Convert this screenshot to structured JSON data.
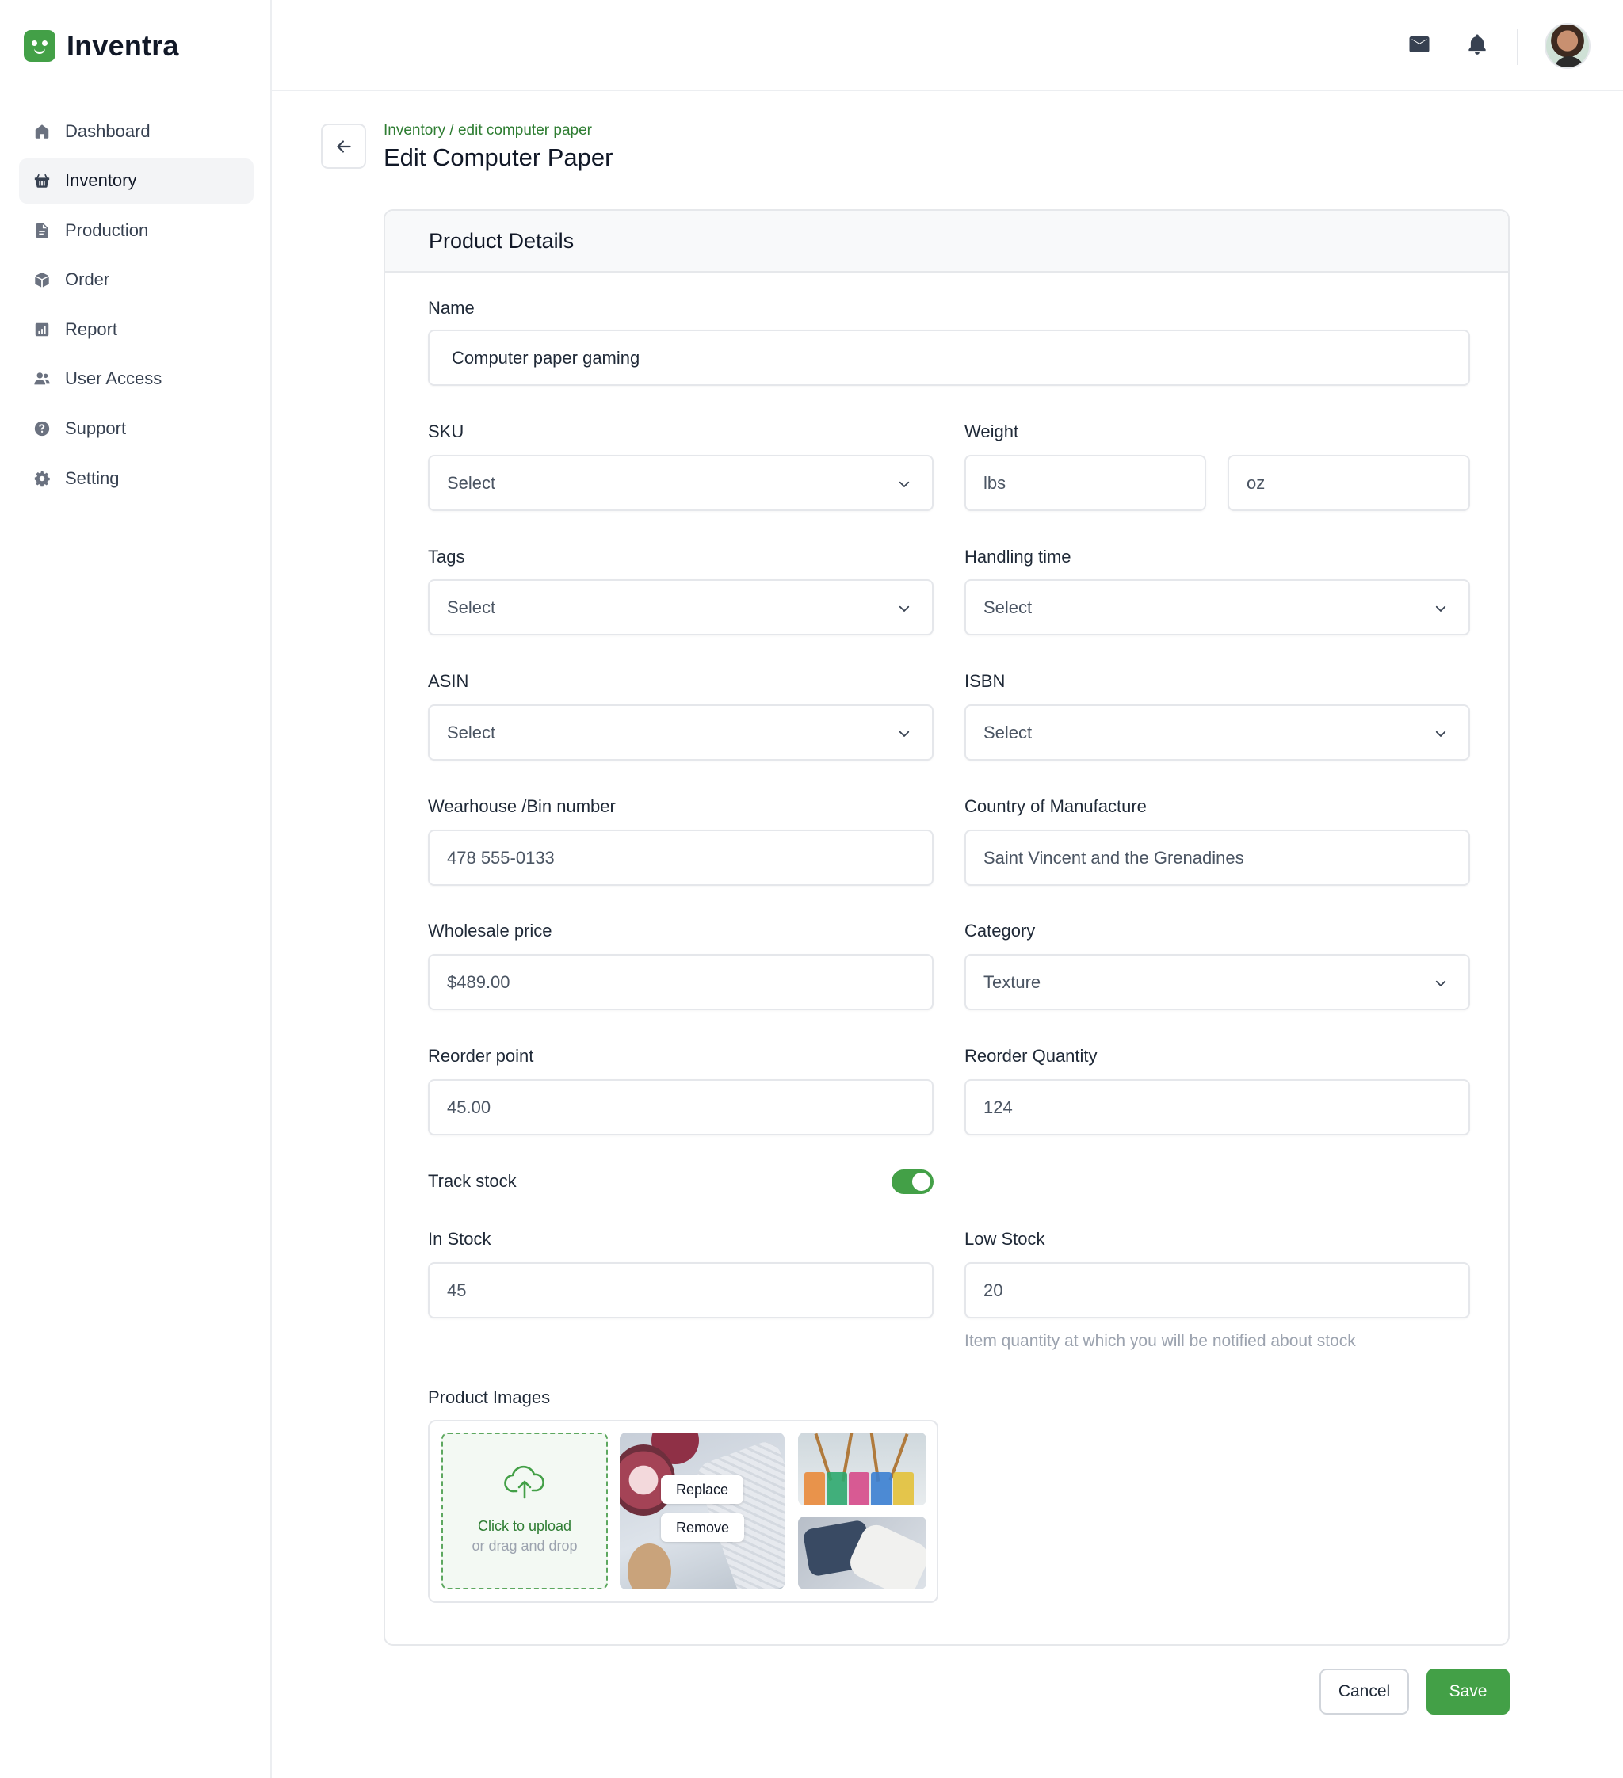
{
  "brand": {
    "name": "Inventra",
    "color": "#43a047"
  },
  "sidebar": {
    "items": [
      {
        "label": "Dashboard",
        "icon": "home-icon",
        "active": false
      },
      {
        "label": "Inventory",
        "icon": "basket-icon",
        "active": true
      },
      {
        "label": "Production",
        "icon": "document-icon",
        "active": false
      },
      {
        "label": "Order",
        "icon": "box-icon",
        "active": false
      },
      {
        "label": "Report",
        "icon": "chart-icon",
        "active": false
      },
      {
        "label": "User Access",
        "icon": "users-icon",
        "active": false
      },
      {
        "label": "Support",
        "icon": "help-icon",
        "active": false
      },
      {
        "label": "Setting",
        "icon": "gear-icon",
        "active": false
      }
    ]
  },
  "topbar": {
    "icons": [
      "mail-icon",
      "bell-icon"
    ]
  },
  "header": {
    "breadcrumb": "Inventory / edit computer paper",
    "title": "Edit Computer Paper"
  },
  "form": {
    "section_title": "Product Details",
    "name": {
      "label": "Name",
      "value": "Computer paper gaming"
    },
    "sku": {
      "label": "SKU",
      "value": "Select"
    },
    "weight": {
      "label": "Weight",
      "lbs_placeholder": "lbs",
      "oz_placeholder": "oz"
    },
    "tags": {
      "label": "Tags",
      "value": "Select"
    },
    "handling_time": {
      "label": "Handling time",
      "value": "Select"
    },
    "asin": {
      "label": "ASIN",
      "value": "Select"
    },
    "isbn": {
      "label": "ISBN",
      "value": "Select"
    },
    "warehouse": {
      "label": "Wearhouse /Bin number",
      "value": "478 555-0133"
    },
    "country": {
      "label": "Country of Manufacture",
      "value": "Saint Vincent and the Grenadines"
    },
    "wholesale_price": {
      "label": "Wholesale price",
      "value": "$489.00"
    },
    "category": {
      "label": "Category",
      "value": "Texture"
    },
    "reorder_point": {
      "label": "Reorder point",
      "value": "45.00"
    },
    "reorder_quantity": {
      "label": "Reorder Quantity",
      "value": "124"
    },
    "track_stock": {
      "label": "Track stock",
      "enabled": true
    },
    "in_stock": {
      "label": "In Stock",
      "value": "45"
    },
    "low_stock": {
      "label": "Low Stock",
      "value": "20",
      "helper": "Item quantity at which you will be notified about stock"
    },
    "images": {
      "label": "Product Images",
      "upload_primary": "Click to upload",
      "upload_secondary": "or drag and drop",
      "replace_label": "Replace",
      "remove_label": "Remove"
    }
  },
  "actions": {
    "cancel_label": "Cancel",
    "save_label": "Save"
  }
}
